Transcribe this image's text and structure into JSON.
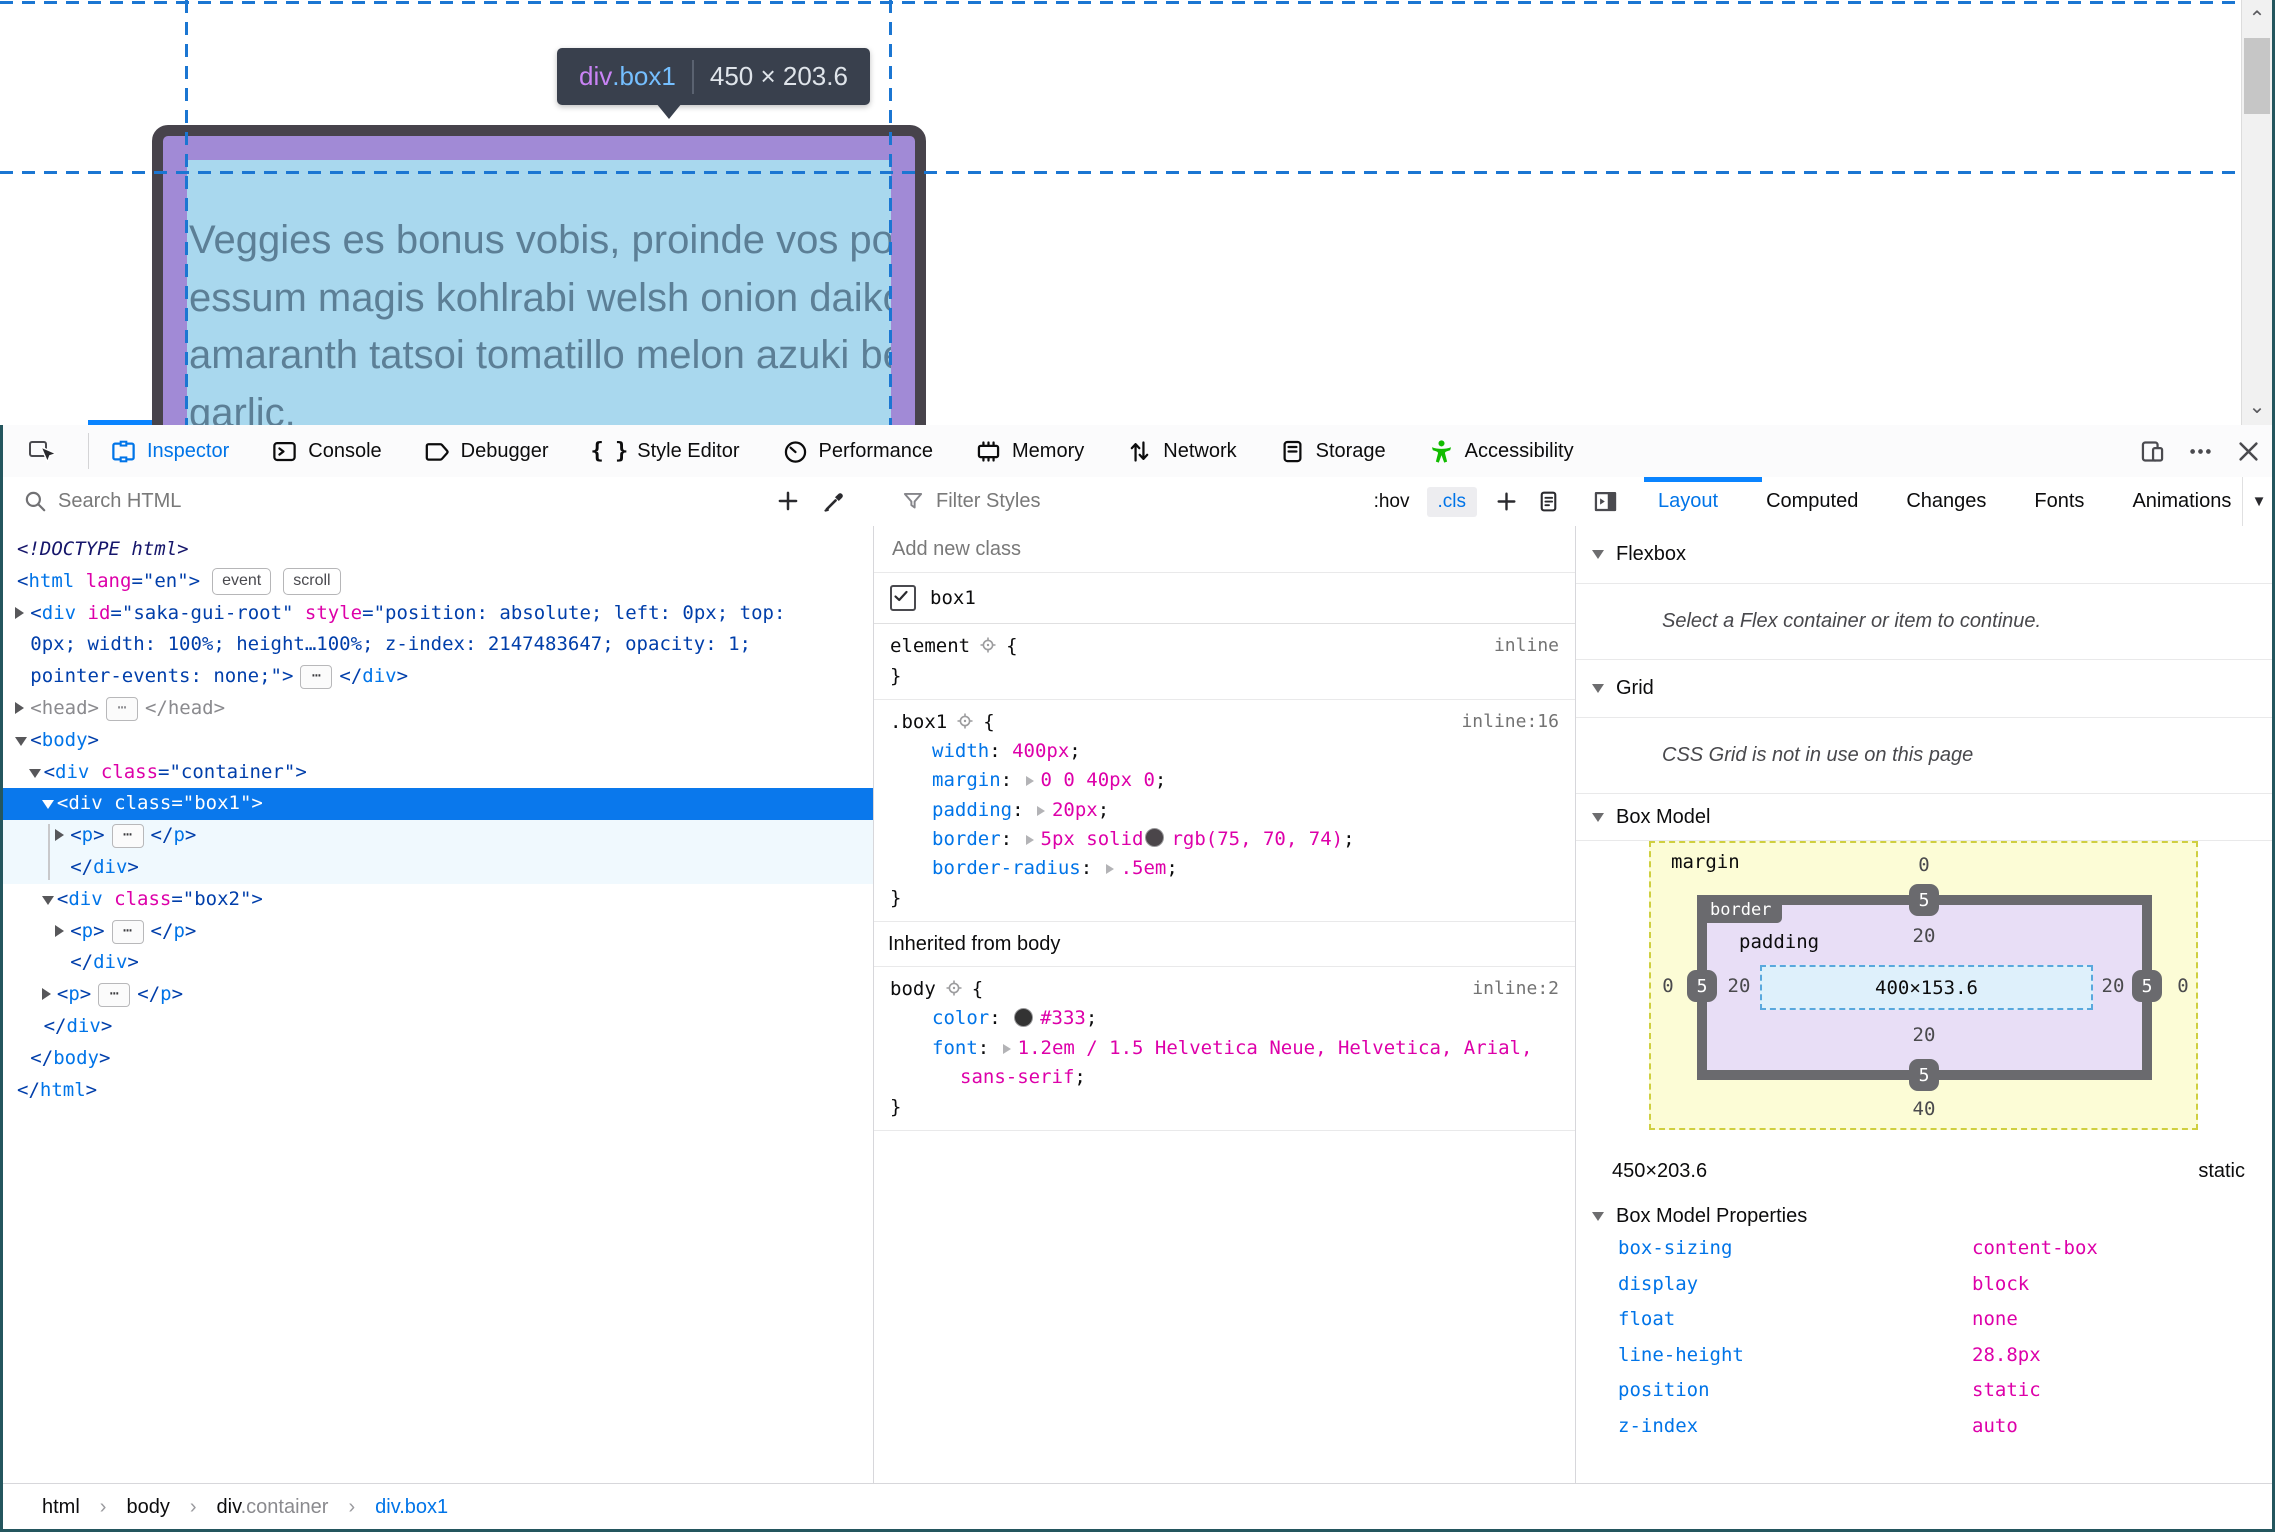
{
  "page": {
    "tooltip": {
      "tag": "div",
      "cls": ".box1",
      "dims": "450 × 203.6"
    },
    "box_text_lines": [
      "Veggies es bonus vobis, proinde vos postulo",
      "essum magis kohlrabi welsh onion daikon",
      "amaranth tatsoi tomatillo melon azuki bean",
      "garlic."
    ]
  },
  "toolbar": {
    "tabs": [
      {
        "label": "Inspector",
        "icon": "inspector",
        "active": true
      },
      {
        "label": "Console",
        "icon": "console"
      },
      {
        "label": "Debugger",
        "icon": "debugger"
      },
      {
        "label": "Style Editor",
        "icon": "braces"
      },
      {
        "label": "Performance",
        "icon": "performance"
      },
      {
        "label": "Memory",
        "icon": "memory"
      },
      {
        "label": "Network",
        "icon": "network"
      },
      {
        "label": "Storage",
        "icon": "storage"
      },
      {
        "label": "Accessibility",
        "icon": "accessibility"
      }
    ]
  },
  "markup_pane": {
    "search_placeholder": "Search HTML",
    "breadcrumbs": [
      {
        "label": "html"
      },
      {
        "label": "body"
      },
      {
        "label": "div",
        "sub": ".container"
      },
      {
        "label": "div.box1",
        "active": true
      }
    ]
  },
  "tree": {
    "lines": [
      {
        "depth": 0,
        "segs": [
          [
            "d",
            "<!DOCTYPE html>"
          ]
        ]
      },
      {
        "depth": 0,
        "segs": [
          [
            "p",
            "<"
          ],
          [
            "t",
            "html"
          ],
          [
            "p",
            " "
          ],
          [
            "a",
            "lang"
          ],
          [
            "p",
            "=\""
          ],
          [
            "v",
            "en"
          ],
          [
            "p",
            "\">"
          ]
        ],
        "badges": [
          "event",
          "scroll"
        ]
      },
      {
        "depth": 1,
        "tw": "r",
        "segs": [
          [
            "p",
            "<"
          ],
          [
            "t",
            "div"
          ],
          [
            "p",
            " "
          ],
          [
            "a",
            "id"
          ],
          [
            "p",
            "=\""
          ],
          [
            "v",
            "saka-gui-root"
          ],
          [
            "p",
            "\" "
          ],
          [
            "a",
            "style"
          ],
          [
            "p",
            "=\""
          ],
          [
            "v",
            "position: absolute; left: 0px; top:"
          ]
        ]
      },
      {
        "depth": 1,
        "cont": true,
        "segs": [
          [
            "v",
            "0px; width: 100%; height…100%; z-index: 2147483647; opacity: 1;"
          ]
        ]
      },
      {
        "depth": 1,
        "cont": true,
        "segs": [
          [
            "v",
            "pointer-events: none;"
          ],
          [
            "p",
            "\">"
          ],
          [
            "e"
          ],
          [
            "p",
            "</"
          ],
          [
            "t",
            "div"
          ],
          [
            "p",
            ">"
          ]
        ]
      },
      {
        "depth": 1,
        "tw": "r",
        "dim": true,
        "segs": [
          [
            "p",
            "<"
          ],
          [
            "t",
            "head"
          ],
          [
            "p",
            ">"
          ],
          [
            "e"
          ],
          [
            "p",
            "</"
          ],
          [
            "t",
            "head"
          ],
          [
            "p",
            ">"
          ]
        ]
      },
      {
        "depth": 1,
        "tw": "d",
        "segs": [
          [
            "p",
            "<"
          ],
          [
            "t",
            "body"
          ],
          [
            "p",
            ">"
          ]
        ]
      },
      {
        "depth": 2,
        "tw": "d",
        "segs": [
          [
            "p",
            "<"
          ],
          [
            "t",
            "div"
          ],
          [
            "p",
            " "
          ],
          [
            "a",
            "class"
          ],
          [
            "p",
            "=\""
          ],
          [
            "v",
            "container"
          ],
          [
            "p",
            "\">"
          ]
        ]
      },
      {
        "depth": 3,
        "tw": "d",
        "sel": true,
        "segs": [
          [
            "p",
            "<"
          ],
          [
            "t",
            "div"
          ],
          [
            "p",
            " "
          ],
          [
            "a",
            "class"
          ],
          [
            "p",
            "=\""
          ],
          [
            "v",
            "box1"
          ],
          [
            "p",
            "\">"
          ]
        ]
      },
      {
        "depth": 4,
        "tw": "r",
        "childbg": true,
        "segs": [
          [
            "p",
            "<"
          ],
          [
            "t",
            "p"
          ],
          [
            "p",
            ">"
          ],
          [
            "e"
          ],
          [
            "p",
            "</"
          ],
          [
            "t",
            "p"
          ],
          [
            "p",
            ">"
          ]
        ]
      },
      {
        "depth": 4,
        "childbg": true,
        "segs": [
          [
            "p",
            "</"
          ],
          [
            "t",
            "div"
          ],
          [
            "p",
            ">"
          ]
        ]
      },
      {
        "depth": 3,
        "tw": "d",
        "segs": [
          [
            "p",
            "<"
          ],
          [
            "t",
            "div"
          ],
          [
            "p",
            " "
          ],
          [
            "a",
            "class"
          ],
          [
            "p",
            "=\""
          ],
          [
            "v",
            "box2"
          ],
          [
            "p",
            "\">"
          ]
        ]
      },
      {
        "depth": 4,
        "tw": "r",
        "segs": [
          [
            "p",
            "<"
          ],
          [
            "t",
            "p"
          ],
          [
            "p",
            ">"
          ],
          [
            "e"
          ],
          [
            "p",
            "</"
          ],
          [
            "t",
            "p"
          ],
          [
            "p",
            ">"
          ]
        ]
      },
      {
        "depth": 4,
        "segs": [
          [
            "p",
            "</"
          ],
          [
            "t",
            "div"
          ],
          [
            "p",
            ">"
          ]
        ]
      },
      {
        "depth": 3,
        "tw": "r",
        "segs": [
          [
            "p",
            "<"
          ],
          [
            "t",
            "p"
          ],
          [
            "p",
            ">"
          ],
          [
            "e"
          ],
          [
            "p",
            "</"
          ],
          [
            "t",
            "p"
          ],
          [
            "p",
            ">"
          ]
        ]
      },
      {
        "depth": 2,
        "segs": [
          [
            "p",
            "</"
          ],
          [
            "t",
            "div"
          ],
          [
            "p",
            ">"
          ]
        ]
      },
      {
        "depth": 1,
        "segs": [
          [
            "p",
            "</"
          ],
          [
            "t",
            "body"
          ],
          [
            "p",
            ">"
          ]
        ]
      },
      {
        "depth": 0,
        "segs": [
          [
            "p",
            "</"
          ],
          [
            "t",
            "html"
          ],
          [
            "p",
            ">"
          ]
        ]
      }
    ]
  },
  "rules": {
    "filter_placeholder": "Filter Styles",
    "pseudo_label": ":hov",
    "cls_label": ".cls",
    "add_class_placeholder": "Add new class",
    "class_toggles": [
      {
        "name": "box1",
        "checked": true
      }
    ],
    "sections": [
      {
        "kind": "rule",
        "selector": "element",
        "loc": "inline",
        "props": []
      },
      {
        "kind": "rule",
        "selector": ".box1",
        "loc": "inline:16",
        "props": [
          {
            "segs": [
              [
                "n",
                "width"
              ],
              [
                "pc",
                ": "
              ],
              [
                "val",
                "400px"
              ],
              [
                "pc",
                ";"
              ]
            ]
          },
          {
            "segs": [
              [
                "n",
                "margin"
              ],
              [
                "pc",
                ": "
              ],
              [
                "ar"
              ],
              [
                "val",
                "0 0 40px 0"
              ],
              [
                "pc",
                ";"
              ]
            ]
          },
          {
            "segs": [
              [
                "n",
                "padding"
              ],
              [
                "pc",
                ": "
              ],
              [
                "ar"
              ],
              [
                "val",
                "20px"
              ],
              [
                "pc",
                ";"
              ]
            ]
          },
          {
            "segs": [
              [
                "n",
                "border"
              ],
              [
                "pc",
                ": "
              ],
              [
                "ar"
              ],
              [
                "val",
                "5px solid"
              ],
              [
                "sw",
                "#4b464a"
              ],
              [
                "val",
                "rgb(75, 70, 74)"
              ],
              [
                "pc",
                ";"
              ]
            ]
          },
          {
            "segs": [
              [
                "n",
                "border-radius"
              ],
              [
                "pc",
                ": "
              ],
              [
                "ar"
              ],
              [
                "val",
                ".5em"
              ],
              [
                "pc",
                ";"
              ]
            ]
          }
        ]
      },
      {
        "kind": "header",
        "text": "Inherited from body"
      },
      {
        "kind": "rule",
        "selector": "body",
        "loc": "inline:2",
        "props": [
          {
            "segs": [
              [
                "n",
                "color"
              ],
              [
                "pc",
                ": "
              ],
              [
                "sw",
                "#333333"
              ],
              [
                "val",
                "#333"
              ],
              [
                "pc",
                ";"
              ]
            ]
          },
          {
            "segs": [
              [
                "n",
                "font"
              ],
              [
                "pc",
                ": "
              ],
              [
                "ar"
              ],
              [
                "val",
                "1.2em / 1.5 Helvetica Neue, Helvetica, Arial,"
              ]
            ]
          },
          {
            "wrap": true,
            "segs": [
              [
                "val",
                "sans-serif"
              ],
              [
                "pc",
                ";"
              ]
            ]
          }
        ]
      }
    ]
  },
  "sidebar": {
    "tabs": [
      {
        "label": "Layout",
        "active": true
      },
      {
        "label": "Computed"
      },
      {
        "label": "Changes"
      },
      {
        "label": "Fonts"
      },
      {
        "label": "Animations"
      }
    ]
  },
  "layout_panel": {
    "flexbox": {
      "title": "Flexbox",
      "message": "Select a Flex container or item to continue."
    },
    "grid": {
      "title": "Grid",
      "message": "CSS Grid is not in use on this page"
    },
    "boxmodel": {
      "title": "Box Model",
      "margin_label": "margin",
      "border_label": "border",
      "padding_label": "padding",
      "margin": {
        "top": "0",
        "right": "0",
        "bottom": "40",
        "left": "0"
      },
      "border": {
        "top": "5",
        "right": "5",
        "bottom": "5",
        "left": "5"
      },
      "padding": {
        "top": "20",
        "right": "20",
        "bottom": "20",
        "left": "20"
      },
      "content": "400×153.6",
      "dims": "450×203.6",
      "position": "static",
      "props_title": "Box Model Properties",
      "properties": [
        {
          "name": "box-sizing",
          "value": "content-box"
        },
        {
          "name": "display",
          "value": "block"
        },
        {
          "name": "float",
          "value": "none"
        },
        {
          "name": "line-height",
          "value": "28.8px"
        },
        {
          "name": "position",
          "value": "static"
        },
        {
          "name": "z-index",
          "value": "auto"
        }
      ]
    }
  },
  "ui": {
    "ellipsis_chip": "⋯",
    "breadcrumb_sep": "›",
    "overflow_arrow": "▼",
    "braces_icon": "{ }"
  }
}
